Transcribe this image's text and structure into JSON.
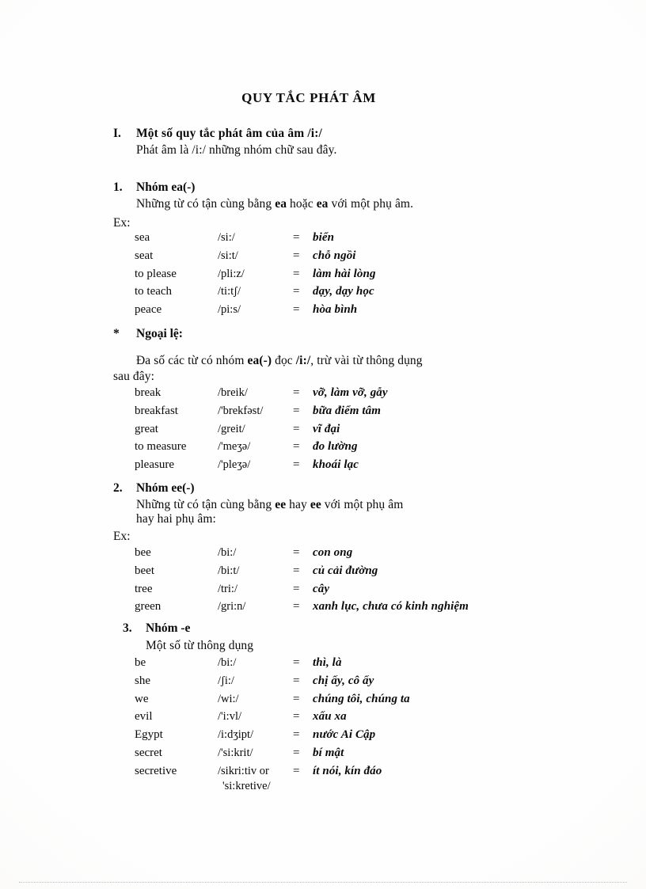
{
  "document": {
    "title": "QUY TẮC PHÁT ÂM"
  },
  "section_I": {
    "marker": "I.",
    "heading": "Một số quy tắc phát âm của âm /i:/",
    "intro": "Phát âm là /i:/ những nhóm chữ sau đây."
  },
  "group1": {
    "marker": "1.",
    "heading": "Nhóm ea(-)",
    "rule_pre": "Những từ có tận cùng bằng ",
    "rule_b1": "ea",
    "rule_mid": " hoặc ",
    "rule_b2": "ea",
    "rule_post": " với một phụ âm.",
    "ex_label": "Ex:",
    "rows": [
      {
        "word": "sea",
        "phonetic": "/si:/",
        "eq": "=",
        "translation": "biển"
      },
      {
        "word": "seat",
        "phonetic": "/si:t/",
        "eq": "=",
        "translation": "chỗ ngồi"
      },
      {
        "word": "to please",
        "phonetic": "/pli:z/",
        "eq": "=",
        "translation": "làm hài lòng"
      },
      {
        "word": "to teach",
        "phonetic": "/ti:tʃ/",
        "eq": "=",
        "translation": "dạy, dạy học"
      },
      {
        "word": "peace",
        "phonetic": "/pi:s/",
        "eq": "=",
        "translation": "hòa bình"
      }
    ]
  },
  "exception": {
    "marker": "*",
    "heading": "Ngoại lệ:",
    "note_pre": "Đa số các từ có nhóm ",
    "note_b1": "ea(-)",
    "note_mid": " đọc ",
    "note_b2": "/i:/",
    "note_post": ", trừ vài từ thông dụng",
    "note_line2": "sau đây:",
    "rows": [
      {
        "word": "break",
        "phonetic": "/breik/",
        "eq": "=",
        "translation": "vỡ, làm vỡ, gẫy"
      },
      {
        "word": "breakfast",
        "phonetic": "/'brekfəst/",
        "eq": "=",
        "translation": "bữa điểm tâm"
      },
      {
        "word": "great",
        "phonetic": "/greit/",
        "eq": "=",
        "translation": "vĩ đại"
      },
      {
        "word": "to measure",
        "phonetic": "/'meʒə/",
        "eq": "=",
        "translation": "đo lường"
      },
      {
        "word": "pleasure",
        "phonetic": "/'pleʒə/",
        "eq": "=",
        "translation": "khoái lạc"
      }
    ]
  },
  "group2": {
    "marker": "2.",
    "heading": "Nhóm ee(-)",
    "rule_pre": "Những từ có tận cùng bằng ",
    "rule_b1": "ee",
    "rule_mid": " hay ",
    "rule_b2": "ee",
    "rule_post": " với một phụ âm",
    "rule_line2": "hay hai phụ âm:",
    "ex_label": "Ex:",
    "rows": [
      {
        "word": "bee",
        "phonetic": "/bi:/",
        "eq": "=",
        "translation": "con ong"
      },
      {
        "word": "beet",
        "phonetic": "/bi:t/",
        "eq": "=",
        "translation": "củ cải đường"
      },
      {
        "word": "tree",
        "phonetic": "/tri:/",
        "eq": "=",
        "translation": "cây"
      },
      {
        "word": "green",
        "phonetic": "/gri:n/",
        "eq": "=",
        "translation": "xanh lục, chưa có kinh nghiệm"
      }
    ]
  },
  "group3": {
    "marker": "3.",
    "heading": "Nhóm -e",
    "subtitle": "Một số từ thông dụng",
    "rows": [
      {
        "word": "be",
        "phonetic": "/bi:/",
        "phonetic2": "",
        "eq": "=",
        "translation": "thì, là"
      },
      {
        "word": "she",
        "phonetic": "/ʃi:/",
        "phonetic2": "",
        "eq": "=",
        "translation": "chị ấy, cô ấy"
      },
      {
        "word": "we",
        "phonetic": "/wi:/",
        "phonetic2": "",
        "eq": "=",
        "translation": "chúng tôi, chúng ta"
      },
      {
        "word": "evil",
        "phonetic": "/'i:vl/",
        "phonetic2": "",
        "eq": "=",
        "translation": "xấu xa"
      },
      {
        "word": "Egypt",
        "phonetic": "/i:dʒipt/",
        "phonetic2": "",
        "eq": "=",
        "translation": "nước Ai Cập"
      },
      {
        "word": "secret",
        "phonetic": "/'si:krit/",
        "phonetic2": "",
        "eq": "=",
        "translation": "bí mật"
      },
      {
        "word": "secretive",
        "phonetic": "/sikri:tiv or",
        "phonetic2": "'si:kretive/",
        "eq": "=",
        "translation": "ít nói, kín đáo"
      }
    ]
  }
}
